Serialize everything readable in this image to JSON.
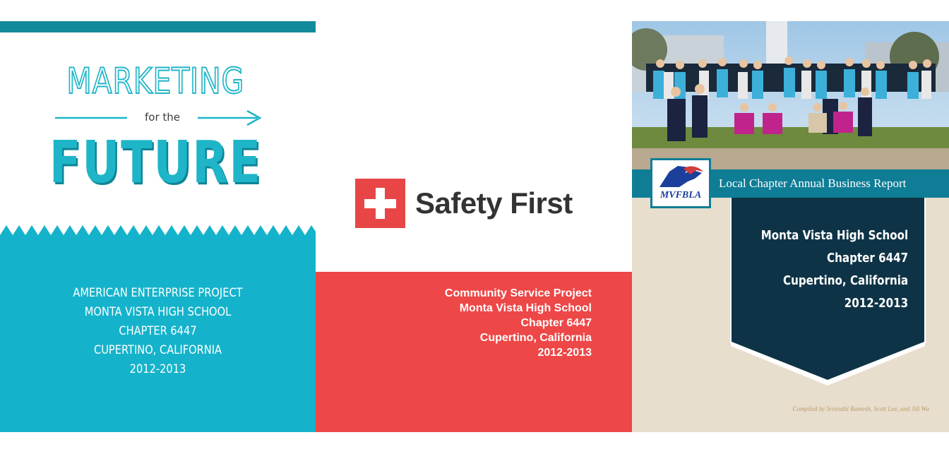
{
  "panel1": {
    "title_top": "MARKETING",
    "title_mid": "for the",
    "title_bottom": "FUTURE",
    "info": [
      "AMERICAN ENTERPRISE PROJECT",
      "MONTA VISTA HIGH SCHOOL",
      "CHAPTER 6447",
      "CUPERTINO, CALIFORNIA",
      "2012-2013"
    ],
    "colors": {
      "accent": "#1fb5c8",
      "band": "#15b3cb",
      "top_bar": "#138a9b"
    }
  },
  "panel2": {
    "title": "Safety First",
    "icon": "red-cross-icon",
    "info": [
      "Community Service Project",
      "Monta Vista High School",
      "Chapter 6447",
      "Cupertino, California",
      "2012-2013"
    ],
    "colors": {
      "accent": "#ee4747",
      "title": "#333333"
    }
  },
  "panel3": {
    "logo_text": "MVFBLA",
    "band_title": "Local Chapter Annual Business Report",
    "info": [
      "Monta Vista High School",
      "Chapter 6447",
      "Cupertino, California",
      "2012-2013"
    ],
    "credit": "Compiled by Srisruthi Ramesh, Scott Lee, and Jill Wu",
    "colors": {
      "band": "#0f7d96",
      "shield": "#0e3346",
      "background": "#e8dece"
    }
  }
}
